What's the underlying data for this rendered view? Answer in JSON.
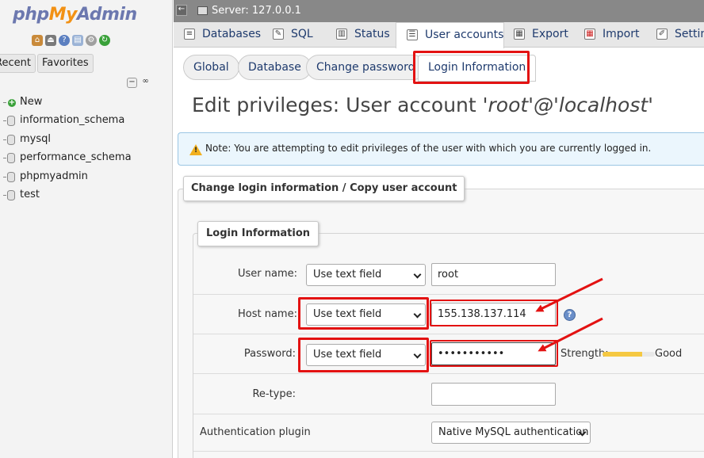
{
  "nav": {
    "logo": {
      "php": "php",
      "my": "My",
      "admin": "Admin"
    },
    "tabs": [
      "Recent",
      "Favorites"
    ],
    "tree": [
      "New",
      "information_schema",
      "mysql",
      "performance_schema",
      "phpmyadmin",
      "test"
    ]
  },
  "server": {
    "label": "Server: 127.0.0.1"
  },
  "main_tabs": [
    "Databases",
    "SQL",
    "Status",
    "User accounts",
    "Export",
    "Import",
    "Settings"
  ],
  "sub_tabs": [
    "Global",
    "Database",
    "Change password",
    "Login Information"
  ],
  "title": {
    "prefix": "Edit privileges: User account ",
    "user": "'root'@'localhost'"
  },
  "notice": {
    "text": "Note: You are attempting to edit privileges of the user with which you are currently logged in."
  },
  "fieldset_outer": {
    "legend": "Change login information / Copy user account"
  },
  "fieldset_inner": {
    "legend": "Login Information"
  },
  "form": {
    "user_name": {
      "label": "User name:",
      "select": "Use text field",
      "value": "root"
    },
    "host_name": {
      "label": "Host name:",
      "select": "Use text field",
      "value": "155.138.137.114"
    },
    "password": {
      "label": "Password:",
      "select": "Use text field",
      "value": "•••••••••••",
      "strength_label": "Strength:",
      "strength_value": "Good",
      "strength_level": 0.75
    },
    "retype": {
      "label": "Re-type:",
      "value": ""
    },
    "auth_plugin": {
      "label": "Authentication plugin",
      "select": "Native MySQL authentication"
    }
  },
  "colors": {
    "highlight": "#e31212",
    "link": "#1e3a6d"
  }
}
